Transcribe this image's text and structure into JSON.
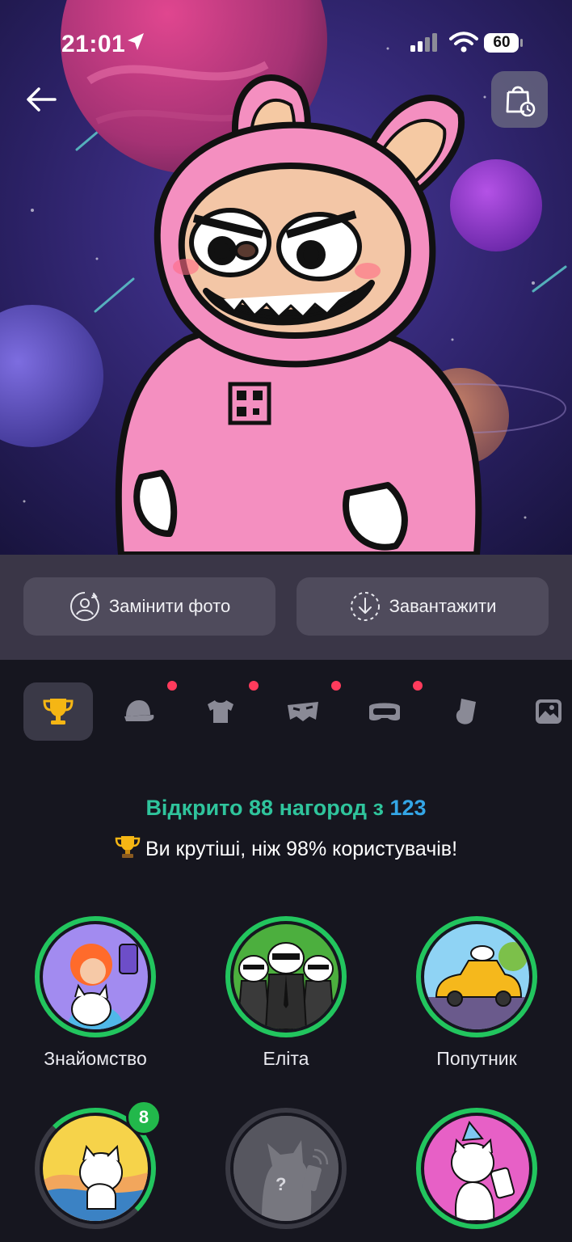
{
  "status_bar": {
    "time": "21:01",
    "battery": "60",
    "icons": [
      "location-arrow-icon",
      "cellular-signal-icon",
      "wifi-icon",
      "battery-icon"
    ]
  },
  "header": {
    "back_icon": "arrow-left-icon",
    "history_icon": "shopping-bag-clock-icon"
  },
  "actions": {
    "replace_photo": "Замінити фото",
    "download": "Завантажити"
  },
  "tabs": [
    {
      "icon": "trophy-icon",
      "active": true,
      "dot": false
    },
    {
      "icon": "cap-icon",
      "active": false,
      "dot": true
    },
    {
      "icon": "tshirt-icon",
      "active": false,
      "dot": true
    },
    {
      "icon": "mask-icon",
      "active": false,
      "dot": true
    },
    {
      "icon": "goggles-icon",
      "active": false,
      "dot": true
    },
    {
      "icon": "glove-icon",
      "active": false,
      "dot": false
    },
    {
      "icon": "image-icon",
      "active": false,
      "dot": false
    }
  ],
  "summary": {
    "opened_prefix": "Відкрито 88 нагород з ",
    "total": "123",
    "rank_text": "Ви крутіші, ніж 98% користувачів!"
  },
  "achievements": [
    {
      "label": "Знайомство",
      "unlocked": true
    },
    {
      "label": "Еліта",
      "unlocked": true
    },
    {
      "label": "Попутник",
      "unlocked": true
    },
    {
      "label": "",
      "unlocked": true,
      "badge": "8"
    },
    {
      "label": "",
      "unlocked": false,
      "locked_mark": "?"
    },
    {
      "label": "",
      "unlocked": true
    }
  ],
  "colors": {
    "background": "#16161f",
    "accent_green": "#2fc49c",
    "accent_blue": "#34a6e6",
    "ring_green": "#22c55e",
    "notification_dot": "#ff3b5c"
  }
}
